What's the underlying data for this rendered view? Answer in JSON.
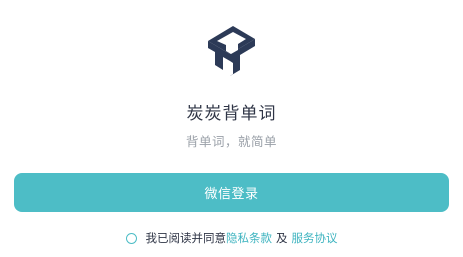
{
  "app": {
    "logo_icon": "t-cube-logo-icon",
    "name": "炭炭背单词",
    "slogan": "背单词，就简单"
  },
  "login": {
    "wechat_label": "微信登录"
  },
  "agreement": {
    "checked": false,
    "prefix": "我已阅读并同意",
    "privacy_label": "隐私条款",
    "joiner": "及",
    "service_label": "服务协议"
  },
  "colors": {
    "accent": "#4dbdc6",
    "link": "#3fb4c0",
    "logo_dark": "#2c3a57",
    "text_dark": "#2f3546",
    "text_muted": "#9aa0a8"
  }
}
